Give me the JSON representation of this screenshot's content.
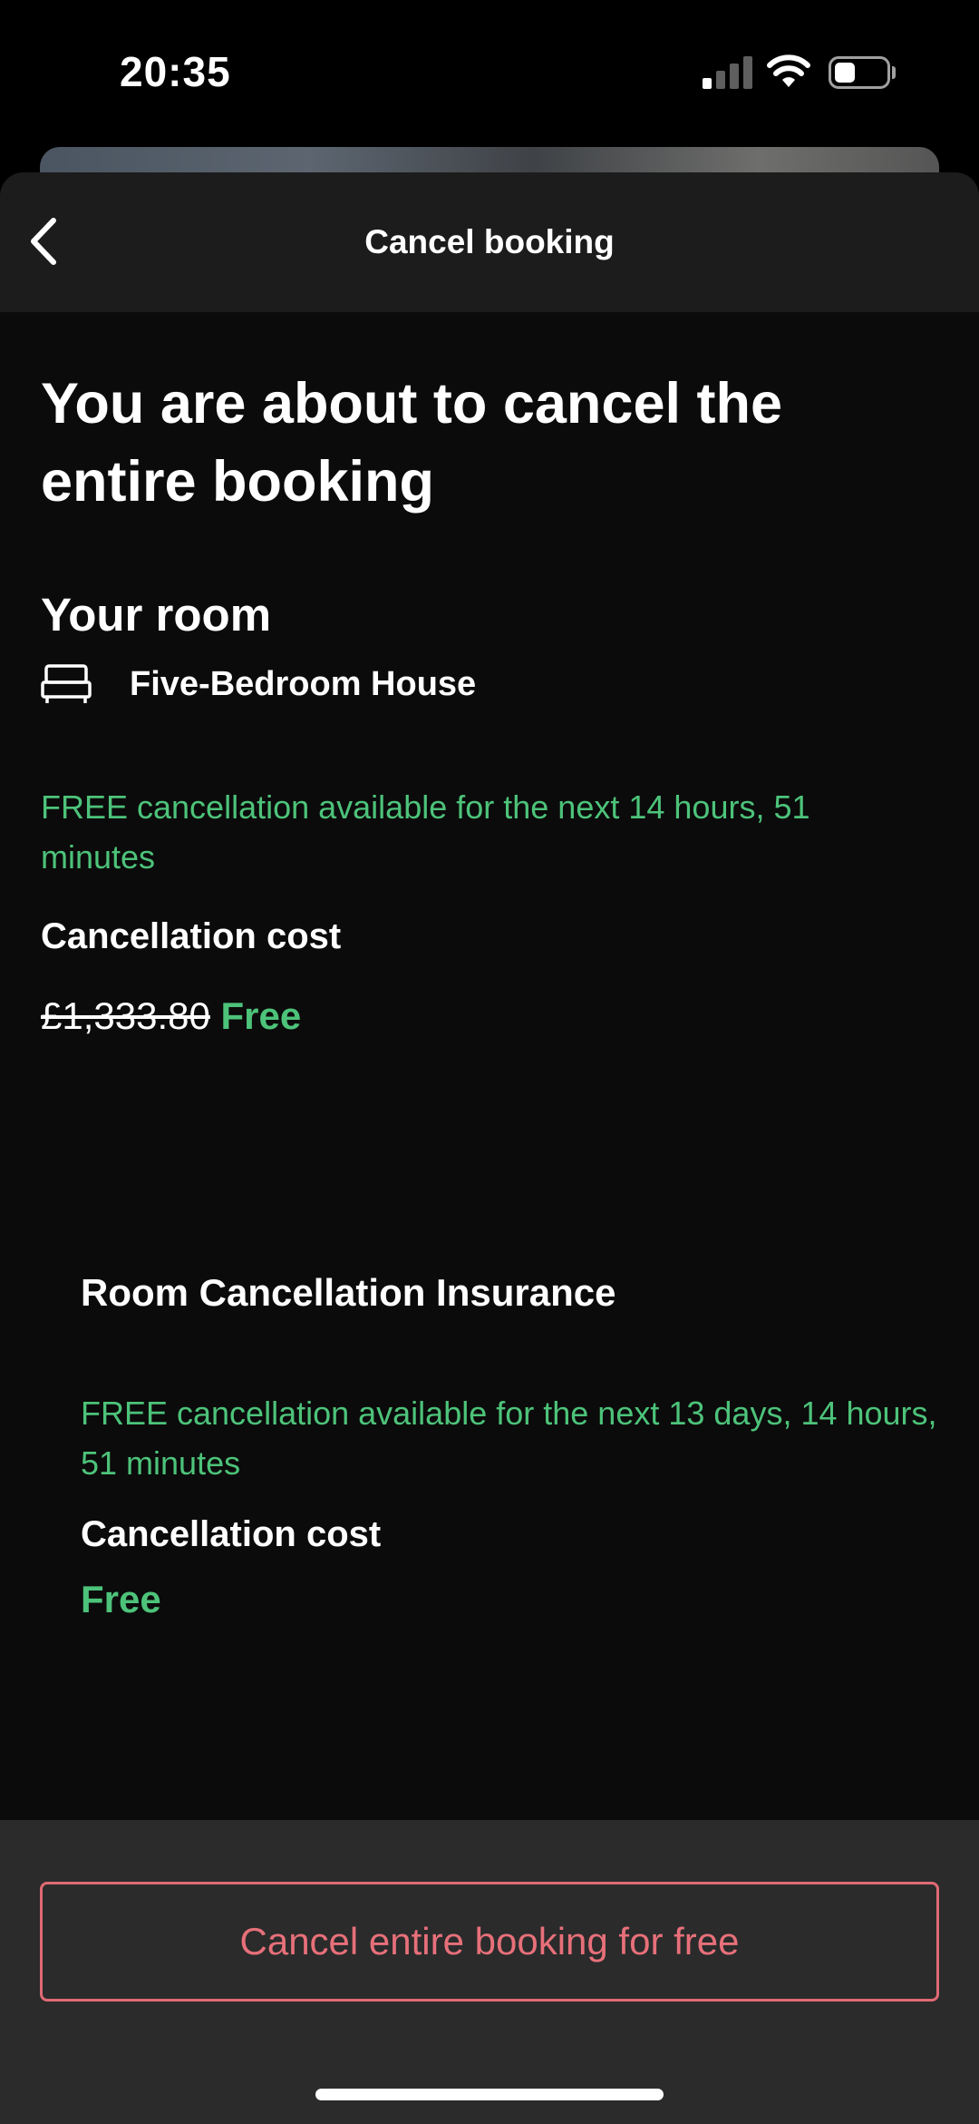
{
  "status_bar": {
    "time": "20:35"
  },
  "nav": {
    "title": "Cancel booking"
  },
  "headline": "You are about to cancel the entire booking",
  "room_section": {
    "title": "Your room",
    "room_name": "Five-Bedroom House",
    "free_cancellation": "FREE cancellation available for the next 14 hours, 51 minutes",
    "cost_label": "Cancellation cost",
    "original_price": "£1,333.80",
    "price": "Free"
  },
  "insurance_section": {
    "title": "Room Cancellation Insurance",
    "free_cancellation": "FREE cancellation available for the next 13 days, 14 hours, 51 minutes",
    "cost_label": "Cancellation cost",
    "price": "Free"
  },
  "bottom": {
    "cancel_button_label": "Cancel entire booking for free"
  },
  "colors": {
    "accent_green": "#4dc37a",
    "danger_red": "#e06a74",
    "background": "#0b0b0b",
    "nav_background": "#1c1c1c"
  },
  "icons": {
    "back": "chevron-left-icon",
    "room": "bed-icon",
    "signal": "cellular-signal-icon",
    "wifi": "wifi-icon",
    "battery": "battery-icon"
  }
}
